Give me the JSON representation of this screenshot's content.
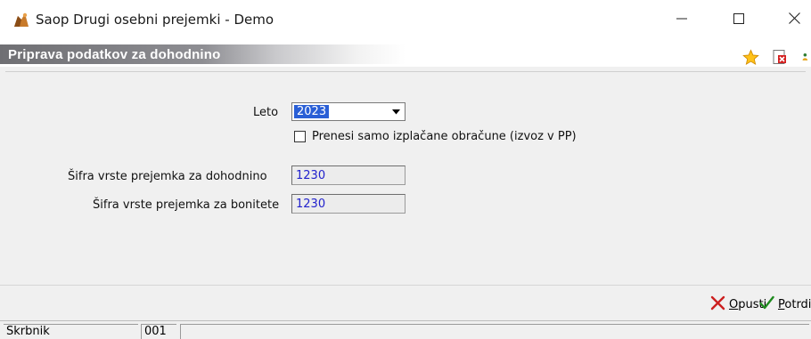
{
  "window": {
    "title": "Saop Drugi osebni prejemki  - Demo",
    "controls": [
      "minimize",
      "maximize",
      "close"
    ]
  },
  "header": {
    "title": "Priprava podatkov za dohodnino",
    "icons": [
      "star-icon",
      "delete-document-icon",
      "person-icon"
    ]
  },
  "form": {
    "year_label": "Leto",
    "year_value": "2023",
    "transfer_checkbox_label": "Prenesi samo izplačane obračune (izvoz v PP)",
    "transfer_checked": false,
    "income_code_label": "Šifra vrste prejemka za dohodnino",
    "income_code_value": "1230",
    "benefit_code_label": "Šifra vrste prejemka za bonitete",
    "benefit_code_value": "1230"
  },
  "buttons": {
    "cancel_mnemonic": "O",
    "cancel_rest": "pusti",
    "confirm_mnemonic": "P",
    "confirm_rest": "otrdi"
  },
  "status": {
    "user": "Skrbnik",
    "code": "001",
    "message": ""
  },
  "colors": {
    "header_band": "#6f6f73",
    "selection": "#2a5fd6",
    "field_text": "#2222cc",
    "cancel_icon": "#cc1f1f",
    "confirm_icon": "#1e8a1e"
  }
}
